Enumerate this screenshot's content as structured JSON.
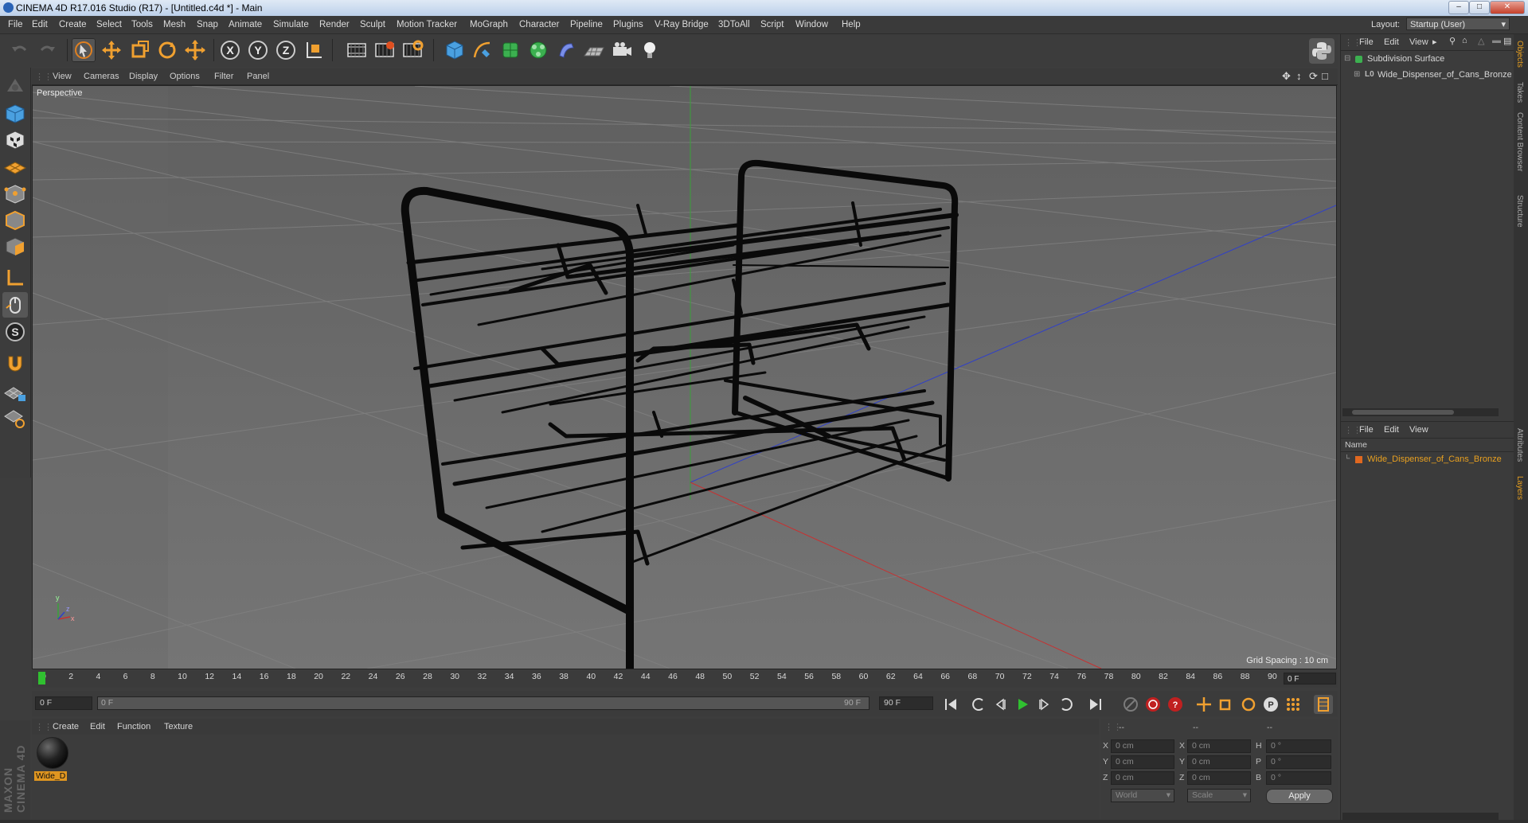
{
  "window": {
    "title": "CINEMA 4D R17.016 Studio (R17) - [Untitled.c4d *] - Main",
    "controls": [
      "minimize",
      "maximize",
      "close"
    ]
  },
  "menubar": {
    "items": [
      "File",
      "Edit",
      "Create",
      "Select",
      "Tools",
      "Mesh",
      "Snap",
      "Animate",
      "Simulate",
      "Render",
      "Sculpt",
      "Motion Tracker",
      "MoGraph",
      "Character",
      "Pipeline",
      "Plugins",
      "V-Ray Bridge",
      "3DToAll",
      "Script",
      "Window",
      "Help"
    ],
    "layout_label": "Layout:",
    "layout_value": "Startup (User)"
  },
  "toolbar": {
    "axis_x": "X",
    "axis_y": "Y",
    "axis_z": "Z"
  },
  "viewport": {
    "menu": [
      "View",
      "Cameras",
      "Display",
      "Options",
      "Filter",
      "Panel"
    ],
    "label": "Perspective",
    "grid_spacing": "Grid Spacing : 10 cm",
    "axis_y": "y",
    "axis_x": "x",
    "axis_z": "z"
  },
  "timeline": {
    "ticks": [
      "0",
      "2",
      "4",
      "6",
      "8",
      "10",
      "12",
      "14",
      "16",
      "18",
      "20",
      "22",
      "24",
      "26",
      "28",
      "30",
      "32",
      "34",
      "36",
      "38",
      "40",
      "42",
      "44",
      "46",
      "48",
      "50",
      "52",
      "54",
      "56",
      "58",
      "60",
      "62",
      "64",
      "66",
      "68",
      "70",
      "72",
      "74",
      "76",
      "78",
      "80",
      "82",
      "84",
      "86",
      "88",
      "90"
    ],
    "current_frame": "0 F",
    "start_field": "0 F",
    "slider_start": "0 F",
    "slider_end": "90 F",
    "end_field": "90 F"
  },
  "materials": {
    "menu": [
      "Create",
      "Edit",
      "Function",
      "Texture"
    ],
    "items": [
      {
        "name": "Wide_D"
      }
    ]
  },
  "coords": {
    "headers": [
      "--",
      "--",
      "--"
    ],
    "rows": [
      {
        "a": "X",
        "av": "0 cm",
        "b": "X",
        "bv": "0 cm",
        "c": "H",
        "cv": "0 °"
      },
      {
        "a": "Y",
        "av": "0 cm",
        "b": "Y",
        "bv": "0 cm",
        "c": "P",
        "cv": "0 °"
      },
      {
        "a": "Z",
        "av": "0 cm",
        "b": "Z",
        "bv": "0 cm",
        "c": "B",
        "cv": "0 °"
      }
    ],
    "mode_world": "World",
    "mode_scale": "Scale",
    "apply": "Apply"
  },
  "objects_panel": {
    "menu": [
      "File",
      "Edit",
      "View"
    ],
    "tree": [
      {
        "name": "Subdivision Surface",
        "level": 0
      },
      {
        "name": "Wide_Dispenser_of_Cans_Bronze",
        "level": 1
      }
    ]
  },
  "layers_panel": {
    "menu": [
      "File",
      "Edit",
      "View"
    ],
    "column": "Name",
    "items": [
      {
        "name": "Wide_Dispenser_of_Cans_Bronze"
      }
    ]
  },
  "right_tabs": [
    "Objects",
    "Takes",
    "Content Browser",
    "Structure",
    "Attributes",
    "Layers"
  ],
  "branding": "MAXON CINEMA 4D",
  "colors": {
    "accent": "#e8a020",
    "viewport_bg": "#6c6c6c",
    "x_axis": "#c03030",
    "y_axis": "#30a030",
    "z_axis": "#3040c0"
  }
}
